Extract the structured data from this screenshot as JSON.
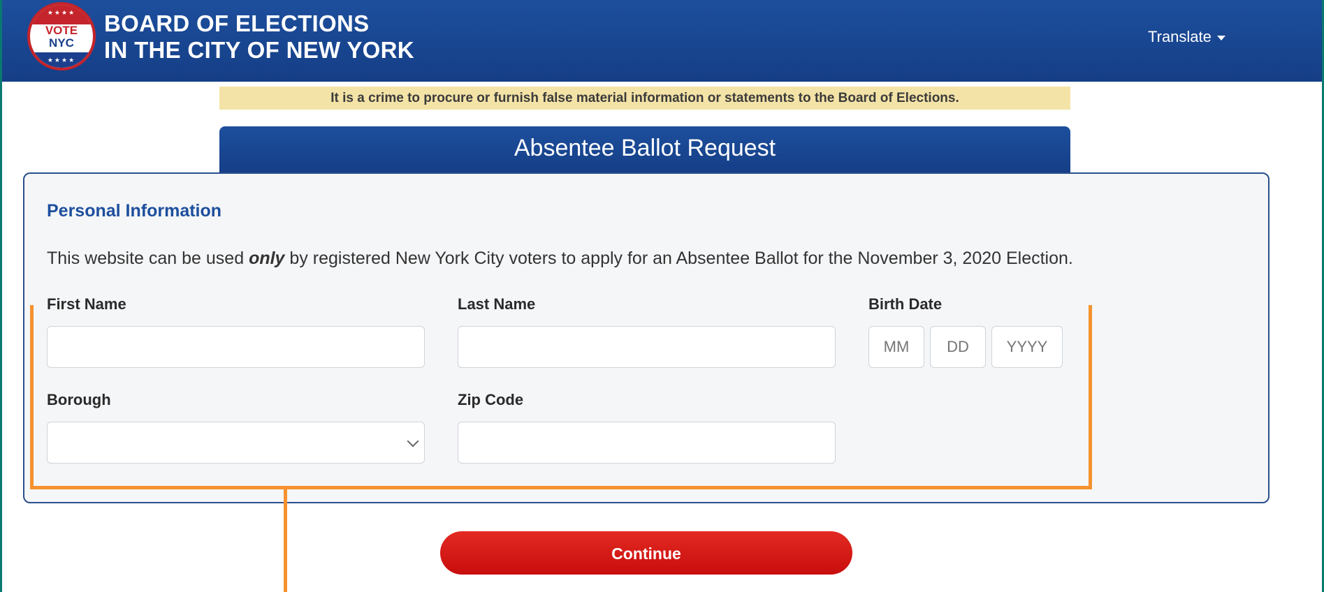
{
  "header": {
    "logo_line1": "VOTE",
    "logo_line2": "NYC",
    "logo_stars": "★★★★",
    "title_line1": "BOARD OF ELECTIONS",
    "title_line2": "IN THE CITY OF NEW YORK",
    "translate_label": "Translate",
    "translate_icon": "caret-down-icon"
  },
  "warning_text": "It is a crime to procure or furnish false material information or statements to the Board of Elections.",
  "form": {
    "heading": "Absentee Ballot Request",
    "section_title": "Personal Information",
    "intro_before": "This website can be used ",
    "intro_emphasis": "only",
    "intro_after": " by registered New York City voters to apply for an Absentee Ballot for the November 3, 2020 Election.",
    "fields": {
      "first_name": {
        "label": "First Name",
        "value": ""
      },
      "last_name": {
        "label": "Last Name",
        "value": ""
      },
      "birth_date": {
        "label": "Birth Date",
        "month_placeholder": "MM",
        "day_placeholder": "DD",
        "year_placeholder": "YYYY"
      },
      "borough": {
        "label": "Borough",
        "selected": ""
      },
      "zip_code": {
        "label": "Zip Code",
        "value": ""
      }
    },
    "continue_label": "Continue"
  },
  "colors": {
    "header_blue": "#153e86",
    "warning_bg": "#f4e3a6",
    "continue_red": "#d4140f",
    "highlight_orange": "#f5922f",
    "page_border_teal": "#0a7a70"
  }
}
